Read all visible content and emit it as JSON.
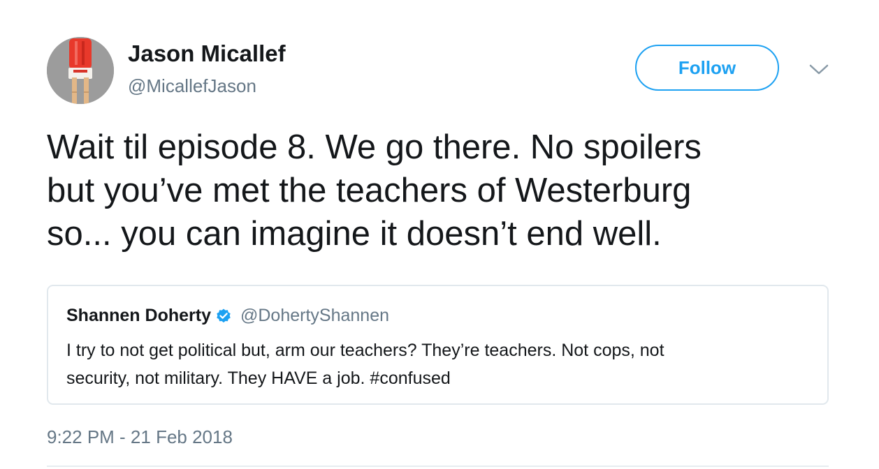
{
  "author": {
    "display_name": "Jason Micallef",
    "handle": "@MicallefJason",
    "avatar_icon": "popsicle-legs-avatar"
  },
  "actions": {
    "follow_label": "Follow",
    "menu_icon": "chevron-down-icon"
  },
  "tweet": {
    "text_lines": [
      "Wait til episode 8. We go there. No spoilers",
      "but you’ve met the teachers of Westerburg",
      "so... you can imagine it doesn’t end well."
    ],
    "timestamp": "9:22 PM - 21 Feb 2018"
  },
  "quoted_tweet": {
    "display_name": "Shannen Doherty",
    "verified": true,
    "handle": "@DohertyShannen",
    "text_lines": [
      "I try to not get political but, arm our teachers? They’re teachers. Not cops, not",
      "security, not military. They HAVE a job. #confused"
    ]
  },
  "colors": {
    "accent": "#1da1f2",
    "secondary_text": "#657786",
    "primary_text": "#14171a",
    "border": "#e1e8ed"
  }
}
